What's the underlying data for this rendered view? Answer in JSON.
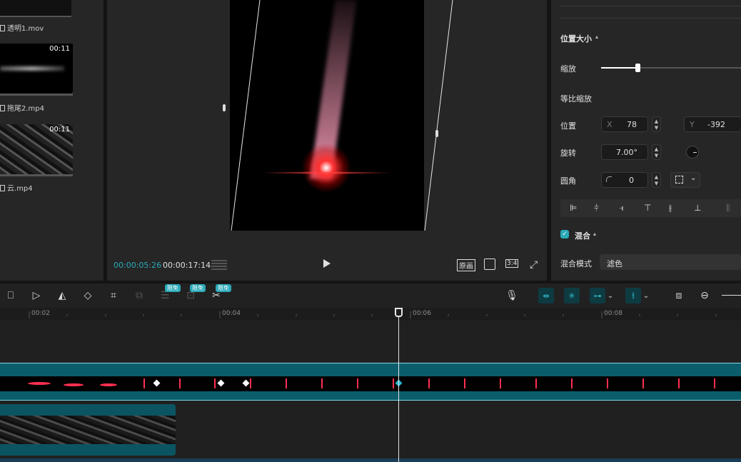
{
  "media": {
    "items": [
      {
        "name": "透明1.mov",
        "duration": ""
      },
      {
        "name": "拖尾2.mp4",
        "duration": "00:11"
      },
      {
        "name": "云.mp4",
        "duration": "00:11"
      }
    ]
  },
  "player": {
    "current_time": "00:00:05:26",
    "total_time": "00:00:17:14",
    "original_label": "原画",
    "ratio_label": "3:4"
  },
  "props": {
    "section_title": "位置大小",
    "scale_label": "缩放",
    "scale_value": 0.26,
    "uniform_scale_label": "等比缩放",
    "position_label": "位置",
    "x_label": "X",
    "x_value": "78",
    "y_label": "Y",
    "y_value": "-392",
    "rotation_label": "旋转",
    "rotation_value": "7.00°",
    "corner_label": "圆角",
    "corner_value": "0",
    "blend_title": "混合",
    "blend_mode_label": "混合模式",
    "blend_mode_value": "滤色"
  },
  "toolbar": {
    "badges": [
      "限免",
      "限免",
      "限免"
    ]
  },
  "ruler": {
    "ticks": [
      "00:02",
      "00:04",
      "00:06",
      "00:08"
    ]
  },
  "colors": {
    "accent": "#2aa9b8",
    "track": "#0b5d6b"
  }
}
